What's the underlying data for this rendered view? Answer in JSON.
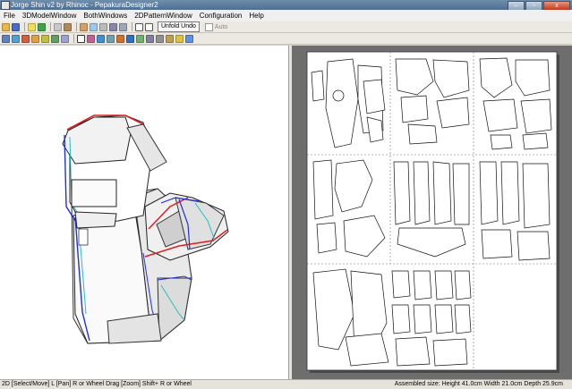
{
  "window": {
    "title": "Jorge Shin v2 by Rhinoc - PepakuraDesigner2",
    "buttons": [
      "–",
      "▫",
      "x"
    ]
  },
  "menu": [
    "File",
    "3DModelWindow",
    "BothWindows",
    "2DPatternWindow",
    "Configuration",
    "Help"
  ],
  "toolbar1": {
    "unfold_undo_label": "Unfold Undo",
    "auto_label": "Auto"
  },
  "status": {
    "left": "2D [Select/Move] L [Pan] R or Wheel Drag [Zoom] Shift+ R or Wheel",
    "right": "Assembled size: Height 41.0cm Width 21.0cm Depth 25.9cm"
  },
  "colors": {
    "title_bar": "#4d6f93",
    "model_mountain": "#e02020",
    "model_valley": "#2030e0",
    "model_flat": "#20c0c0",
    "pattern_bg": "#6e6e6e"
  }
}
